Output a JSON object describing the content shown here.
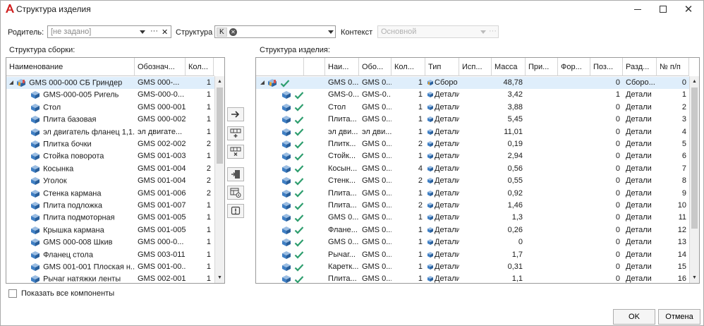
{
  "window": {
    "title": "Структура изделия"
  },
  "top": {
    "parent_label": "Родитель:",
    "parent_placeholder": "[не задано]",
    "parent_dots": "···",
    "parent_clear": "✕",
    "structure_label": "Структура",
    "structure_tag": "K",
    "context_label": "Контекст",
    "context_value": "Основной",
    "context_dots": "···"
  },
  "left_panel": {
    "title": "Структура сборки:",
    "columns": [
      "Наименование",
      "Обознач...",
      "Кол..."
    ],
    "rows": [
      {
        "name": "GMS 000-000 СБ Гриндер",
        "code": "GMS 000-...",
        "qty": "1",
        "level": 0,
        "asm": true
      },
      {
        "name": "GMS-000-005 Ригель",
        "code": "GMS-000-0...",
        "qty": "1",
        "level": 1
      },
      {
        "name": "Стол",
        "code": "GMS 000-001",
        "qty": "1",
        "level": 1
      },
      {
        "name": "Плита базовая",
        "code": "GMS 000-002",
        "qty": "1",
        "level": 1
      },
      {
        "name": "эл двигатель фланец 1,1...",
        "code": "эл двигате...",
        "qty": "1",
        "level": 1
      },
      {
        "name": "Плитка бочки",
        "code": "GMS 002-002",
        "qty": "2",
        "level": 1
      },
      {
        "name": "Стойка поворота",
        "code": "GMS 001-003",
        "qty": "1",
        "level": 1
      },
      {
        "name": "Косынка",
        "code": "GMS 001-004",
        "qty": "2",
        "level": 1
      },
      {
        "name": "Уголок",
        "code": "GMS 001-004",
        "qty": "2",
        "level": 1
      },
      {
        "name": "Стенка кармана",
        "code": "GMS 001-006",
        "qty": "2",
        "level": 1
      },
      {
        "name": "Плита подложка",
        "code": "GMS 001-007",
        "qty": "1",
        "level": 1
      },
      {
        "name": "Плита подмоторная",
        "code": "GMS 001-005",
        "qty": "1",
        "level": 1
      },
      {
        "name": "Крышка кармана",
        "code": "GMS 001-005",
        "qty": "1",
        "level": 1
      },
      {
        "name": "GMS 000-008 Шкив",
        "code": "GMS 000-0...",
        "qty": "1",
        "level": 1
      },
      {
        "name": "Фланец стола",
        "code": "GMS 003-011",
        "qty": "1",
        "level": 1
      },
      {
        "name": "GMS 001-001 Плоская н...",
        "code": "GMS 001-00...",
        "qty": "1",
        "level": 1
      },
      {
        "name": "Рычаг натяжки ленты",
        "code": "GMS 002-001",
        "qty": "1",
        "level": 1
      }
    ]
  },
  "toolbar": {
    "add_icon": "arrow-right-icon",
    "insert_icon": "insert-row-icon",
    "delete_icon": "delete-row-icon",
    "export_icon": "export-icon",
    "settings_icon": "table-settings-icon",
    "warning_icon": "warning-icon"
  },
  "right_panel": {
    "title": "Структура изделия:",
    "columns": [
      "Наи...",
      "Обо...",
      "Кол...",
      "Тип",
      "Исп...",
      "Масса",
      "При...",
      "Фор...",
      "Поз...",
      "Разд...",
      "№ п/п"
    ],
    "rows": [
      {
        "name": "GMS 0...",
        "code": "GMS 0...",
        "qty": "1",
        "type": "Сборо",
        "mass": "48,78",
        "pos": "0",
        "section": "Сборо...",
        "no": "0",
        "level": 0,
        "asm": true
      },
      {
        "name": "GMS-0...",
        "code": "GMS-0...",
        "qty": "1",
        "type": "Детали",
        "mass": "3,42",
        "pos": "1",
        "section": "Детали",
        "no": "1",
        "level": 1
      },
      {
        "name": "Стол",
        "code": "GMS 0...",
        "qty": "1",
        "type": "Детали",
        "mass": "3,88",
        "pos": "0",
        "section": "Детали",
        "no": "2",
        "level": 1
      },
      {
        "name": "Плита...",
        "code": "GMS 0...",
        "qty": "1",
        "type": "Детали",
        "mass": "5,45",
        "pos": "0",
        "section": "Детали",
        "no": "3",
        "level": 1
      },
      {
        "name": "эл дви...",
        "code": "эл дви...",
        "qty": "1",
        "type": "Детали",
        "mass": "11,01",
        "pos": "0",
        "section": "Детали",
        "no": "4",
        "level": 1
      },
      {
        "name": "Плитк...",
        "code": "GMS 0...",
        "qty": "2",
        "type": "Детали",
        "mass": "0,19",
        "pos": "0",
        "section": "Детали",
        "no": "5",
        "level": 1
      },
      {
        "name": "Стойк...",
        "code": "GMS 0...",
        "qty": "1",
        "type": "Детали",
        "mass": "2,94",
        "pos": "0",
        "section": "Детали",
        "no": "6",
        "level": 1
      },
      {
        "name": "Косын...",
        "code": "GMS 0...",
        "qty": "4",
        "type": "Детали",
        "mass": "0,56",
        "pos": "0",
        "section": "Детали",
        "no": "7",
        "level": 1
      },
      {
        "name": "Стенк...",
        "code": "GMS 0...",
        "qty": "2",
        "type": "Детали",
        "mass": "0,55",
        "pos": "0",
        "section": "Детали",
        "no": "8",
        "level": 1
      },
      {
        "name": "Плита...",
        "code": "GMS 0...",
        "qty": "1",
        "type": "Детали",
        "mass": "0,92",
        "pos": "0",
        "section": "Детали",
        "no": "9",
        "level": 1
      },
      {
        "name": "Плита...",
        "code": "GMS 0...",
        "qty": "2",
        "type": "Детали",
        "mass": "1,46",
        "pos": "0",
        "section": "Детали",
        "no": "10",
        "level": 1
      },
      {
        "name": "GMS 0...",
        "code": "GMS 0...",
        "qty": "1",
        "type": "Детали",
        "mass": "1,3",
        "pos": "0",
        "section": "Детали",
        "no": "11",
        "level": 1
      },
      {
        "name": "Фланe...",
        "code": "GMS 0...",
        "qty": "1",
        "type": "Детали",
        "mass": "0,26",
        "pos": "0",
        "section": "Детали",
        "no": "12",
        "level": 1
      },
      {
        "name": "GMS 0...",
        "code": "GMS 0...",
        "qty": "1",
        "type": "Детали",
        "mass": "0",
        "pos": "0",
        "section": "Детали",
        "no": "13",
        "level": 1
      },
      {
        "name": "Рычаг...",
        "code": "GMS 0...",
        "qty": "1",
        "type": "Детали",
        "mass": "1,7",
        "pos": "0",
        "section": "Детали",
        "no": "14",
        "level": 1
      },
      {
        "name": "Каретк...",
        "code": "GMS 0...",
        "qty": "1",
        "type": "Детали",
        "mass": "0,31",
        "pos": "0",
        "section": "Детали",
        "no": "15",
        "level": 1
      },
      {
        "name": "Плита...",
        "code": "GMS 0...",
        "qty": "1",
        "type": "Детали",
        "mass": "1,1",
        "pos": "0",
        "section": "Детали",
        "no": "16",
        "level": 1
      }
    ]
  },
  "bottom": {
    "show_all_label": "Показать все компоненты",
    "ok_label": "OK",
    "cancel_label": "Отмена"
  },
  "colors": {
    "accent": "#d01f1f",
    "selection": "#dfeefb",
    "check": "#2e9e6e",
    "part_blue": "#3f7fc4"
  }
}
